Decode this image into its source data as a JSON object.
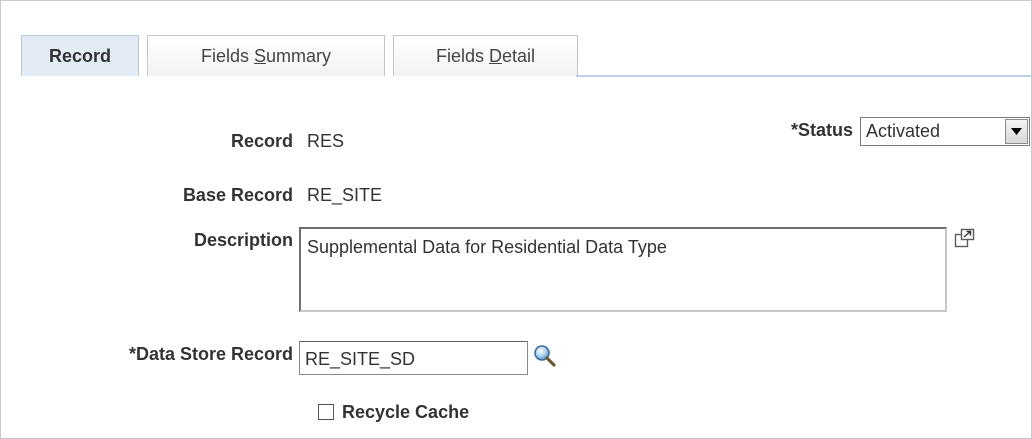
{
  "tabs": [
    {
      "label_pre": "Record",
      "label_u": "",
      "label_post": "",
      "active": true
    },
    {
      "label_pre": "Fields ",
      "label_u": "S",
      "label_post": "ummary",
      "active": false
    },
    {
      "label_pre": "Fields ",
      "label_u": "D",
      "label_post": "etail",
      "active": false
    }
  ],
  "form": {
    "record_label": "Record",
    "record_value": "RES",
    "status_label": "*Status",
    "status_value": "Activated",
    "base_record_label": "Base Record",
    "base_record_value": "RE_SITE",
    "description_label": "Description",
    "description_value": "Supplemental Data for Residential Data Type",
    "data_store_label": "*Data Store Record",
    "data_store_value": "RE_SITE_SD",
    "recycle_cache_label": "Recycle Cache",
    "recycle_cache_checked": false
  },
  "icons": {
    "expand": "expand-icon",
    "lookup": "search-icon",
    "dropdown": "chevron-down-icon"
  },
  "colors": {
    "active_tab_bg": "#e3ecf5",
    "tab_underline": "#bcd0e3"
  }
}
